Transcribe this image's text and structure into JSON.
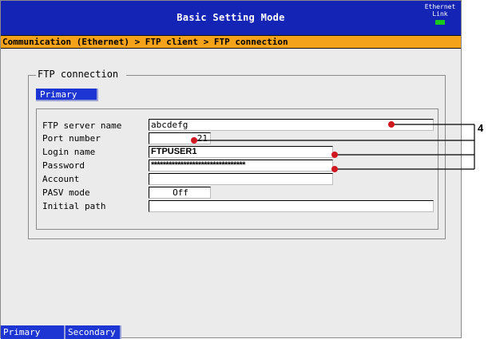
{
  "header": {
    "title": "Basic Setting Mode",
    "ethernet_line1": "Ethernet",
    "ethernet_line2": "Link",
    "link_led_color": "#19c81e"
  },
  "breadcrumb": "Communication (Ethernet) > FTP client > FTP connection",
  "group": {
    "title": "FTP connection",
    "active_tab": "Primary"
  },
  "fields": {
    "server_name": {
      "label": "FTP server name",
      "value": "abcdefg"
    },
    "port": {
      "label": "Port number",
      "value": "21"
    },
    "login": {
      "label": "Login name",
      "value": "FTPUSER1"
    },
    "password": {
      "label": "Password",
      "value": "********************************"
    },
    "account": {
      "label": "Account",
      "value": ""
    },
    "pasv": {
      "label": "PASV mode",
      "value": "Off"
    },
    "path": {
      "label": "Initial path",
      "value": ""
    }
  },
  "bottom_tabs": [
    "Primary",
    "Secondary"
  ],
  "annotation": {
    "number": "4",
    "marker_color": "#d01820"
  }
}
